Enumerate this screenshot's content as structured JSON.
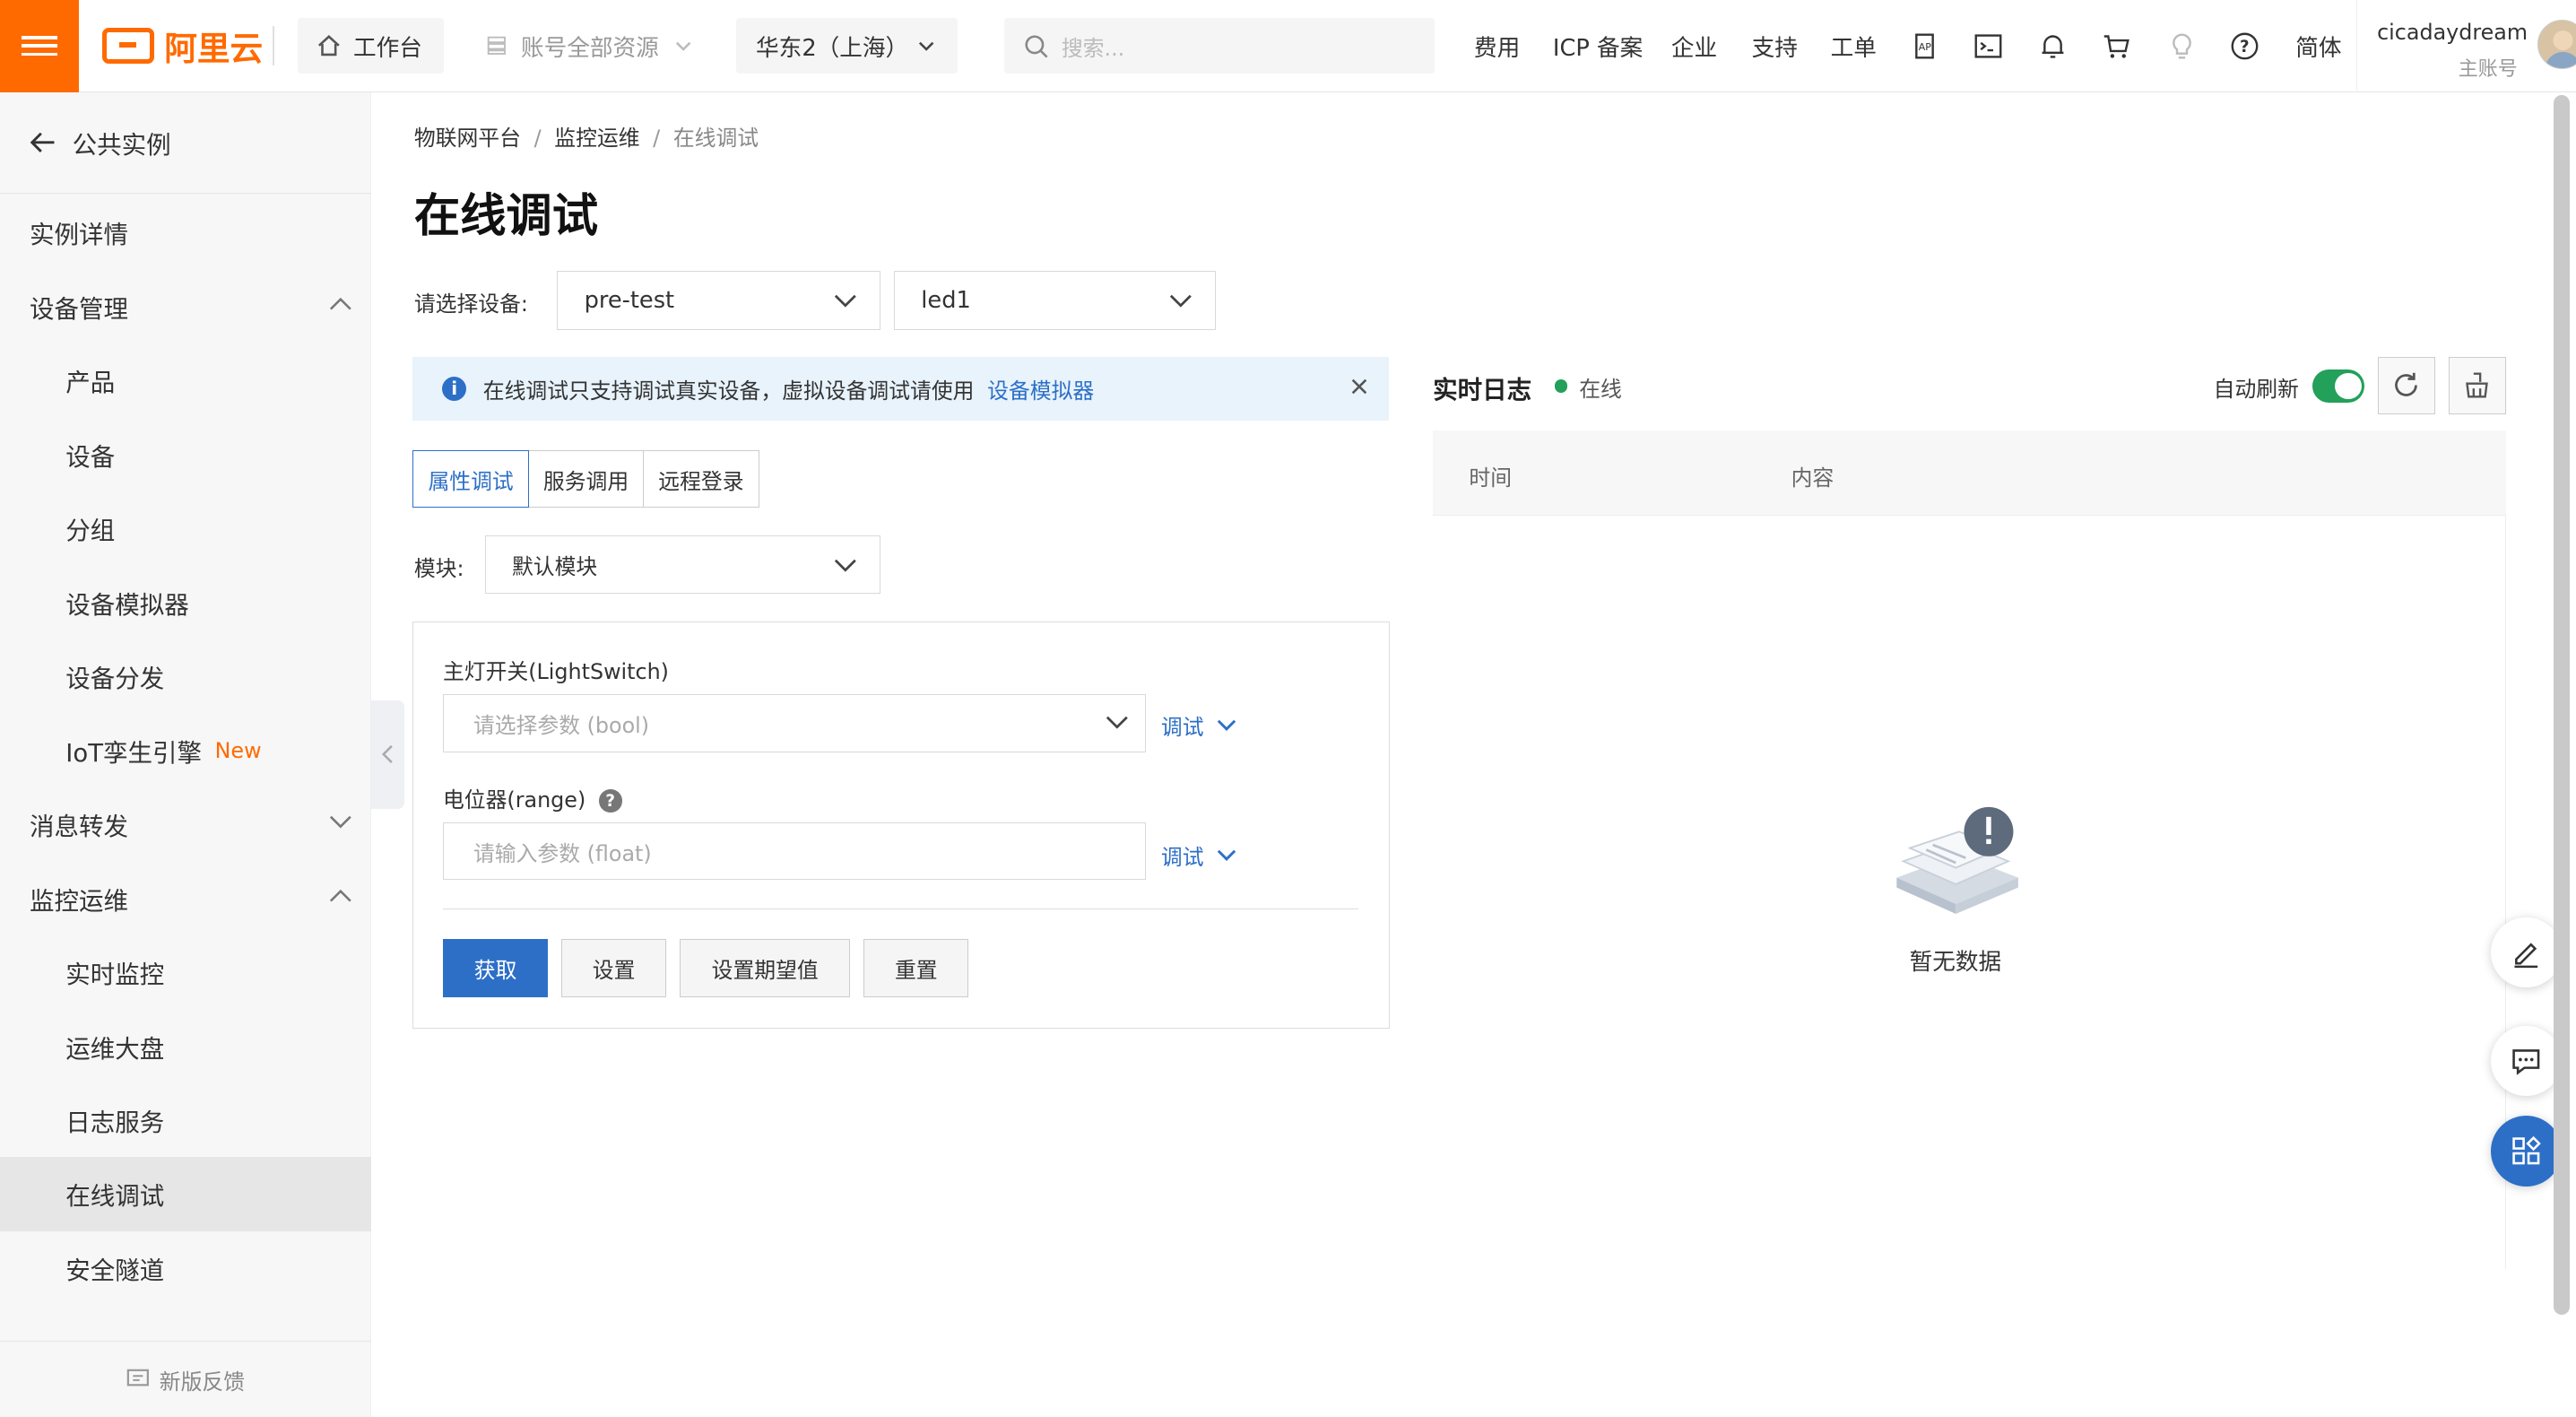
{
  "header": {
    "logo_text": "阿里云",
    "workbench": "工作台",
    "resources": "账号全部资源",
    "region": "华东2（上海）",
    "search_placeholder": "搜索...",
    "nav": [
      "费用",
      "ICP 备案",
      "企业",
      "支持",
      "工单"
    ],
    "lang": "简体",
    "username": "cicadaydream",
    "user_role": "主账号",
    "accent_color": "#ff6a00"
  },
  "sidebar": {
    "back_label": "公共实例",
    "items": [
      {
        "label": "实例详情",
        "level": 1
      },
      {
        "label": "设备管理",
        "level": 1,
        "expanded": true
      },
      {
        "label": "产品",
        "level": 2
      },
      {
        "label": "设备",
        "level": 2
      },
      {
        "label": "分组",
        "level": 2
      },
      {
        "label": "设备模拟器",
        "level": 2
      },
      {
        "label": "设备分发",
        "level": 2
      },
      {
        "label": "IoT孪生引擎",
        "level": 2,
        "badge": "New"
      },
      {
        "label": "消息转发",
        "level": 1,
        "expanded": false
      },
      {
        "label": "监控运维",
        "level": 1,
        "expanded": true
      },
      {
        "label": "实时监控",
        "level": 2
      },
      {
        "label": "运维大盘",
        "level": 2
      },
      {
        "label": "日志服务",
        "level": 2
      },
      {
        "label": "在线调试",
        "level": 2,
        "active": true
      },
      {
        "label": "安全隧道",
        "level": 2
      }
    ],
    "feedback": "新版反馈"
  },
  "main": {
    "breadcrumb": [
      "物联网平台",
      "监控运维",
      "在线调试"
    ],
    "title": "在线调试",
    "device_label": "请选择设备:",
    "product_value": "pre-test",
    "device_value": "led1",
    "notice_text": "在线调试只支持调试真实设备，虚拟设备调试请使用",
    "notice_link": "设备模拟器",
    "tabs": [
      "属性调试",
      "服务调用",
      "远程登录"
    ],
    "module_label": "模块:",
    "module_value": "默认模块",
    "field1_label": "主灯开关(LightSwitch)",
    "field1_placeholder": "请选择参数 (bool)",
    "field2_label": "电位器(range)",
    "field2_placeholder": "请输入参数 (float)",
    "debug_label": "调试",
    "buttons": {
      "get": "获取",
      "set": "设置",
      "set_expected": "设置期望值",
      "reset": "重置"
    }
  },
  "log": {
    "title": "实时日志",
    "status": "在线",
    "auto_refresh": "自动刷新",
    "auto_refresh_on": true,
    "columns": [
      "时间",
      "内容"
    ],
    "empty": "暂无数据",
    "status_color": "#23a05a"
  }
}
